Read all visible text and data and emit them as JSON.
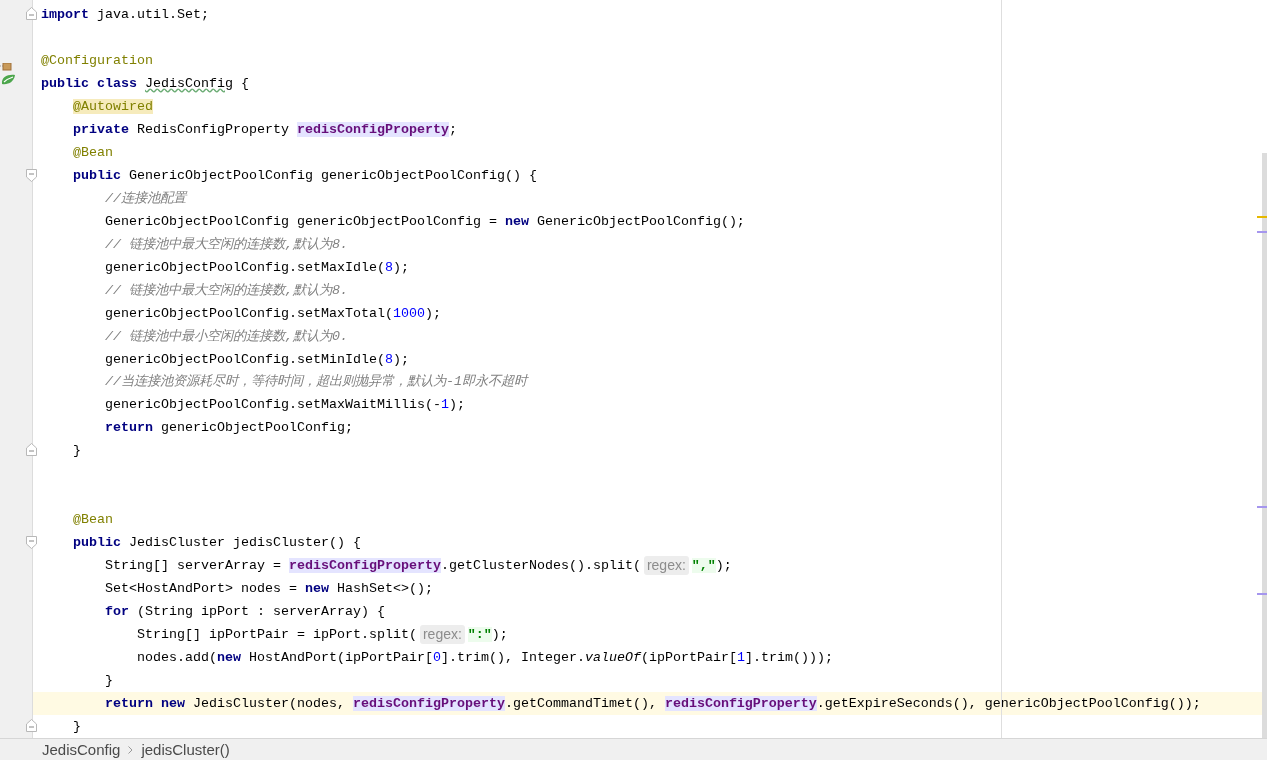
{
  "editor": {
    "lines": [
      {
        "gutter_icons": [
          {
            "kind": "fold-end"
          }
        ],
        "current": false,
        "tokens": [
          {
            "kind": "keyword",
            "text": "import"
          },
          {
            "kind": "plain",
            "text": " java.util.Set;"
          }
        ]
      },
      {
        "current": false
      },
      {
        "current": false,
        "tokens": [
          {
            "kind": "annotation",
            "text": "@Configuration"
          }
        ]
      },
      {
        "current": false,
        "gutter_icons": [
          {
            "kind": "spring-bean"
          }
        ],
        "tokens": [
          {
            "kind": "keyword",
            "text": "public class "
          },
          {
            "kind": "typo",
            "text": "JedisConfig"
          },
          {
            "kind": "plain",
            "text": " {"
          }
        ],
        "children": [
          {
            "current": false,
            "tokens": [
              {
                "kind": "annotation_marked",
                "text": "@Autowired"
              }
            ]
          },
          {
            "current": false,
            "tokens": [
              {
                "kind": "keyword",
                "text": "private"
              },
              {
                "kind": "plain",
                "text": " RedisConfigProperty "
              },
              {
                "kind": "field",
                "text": "redisConfigProperty"
              },
              {
                "kind": "plain",
                "text": ";"
              }
            ]
          },
          {
            "current": false,
            "tokens": [
              {
                "kind": "annotation",
                "text": "@Bean"
              }
            ]
          },
          {
            "gutter_icons": [
              {
                "kind": "fold-start"
              }
            ],
            "current": false,
            "tokens": [
              {
                "kind": "keyword",
                "text": "public"
              },
              {
                "kind": "plain",
                "text": " GenericObjectPoolConfig genericObjectPoolConfig() {"
              }
            ],
            "children": [
              {
                "current": false,
                "tokens": [
                  {
                    "kind": "comment",
                    "text": "//连接池配置"
                  }
                ]
              },
              {
                "current": false,
                "tokens": [
                  {
                    "kind": "plain",
                    "text": "GenericObjectPoolConfig genericObjectPoolConfig = "
                  },
                  {
                    "kind": "keyword",
                    "text": "new"
                  },
                  {
                    "kind": "plain",
                    "text": " GenericObjectPoolConfig();"
                  }
                ]
              },
              {
                "current": false,
                "tokens": [
                  {
                    "kind": "comment",
                    "text": "// 链接池中最大空闲的连接数,默认为8."
                  }
                ]
              },
              {
                "current": false,
                "tokens": [
                  {
                    "kind": "plain",
                    "text": "genericObjectPoolConfig.setMaxIdle("
                  },
                  {
                    "kind": "number",
                    "text": "8"
                  },
                  {
                    "kind": "plain",
                    "text": ");"
                  }
                ]
              },
              {
                "current": false,
                "tokens": [
                  {
                    "kind": "comment",
                    "text": "// 链接池中最大空闲的连接数,默认为8."
                  }
                ]
              },
              {
                "current": false,
                "tokens": [
                  {
                    "kind": "plain",
                    "text": "genericObjectPoolConfig.setMaxTotal("
                  },
                  {
                    "kind": "number",
                    "text": "1000"
                  },
                  {
                    "kind": "plain",
                    "text": ");"
                  }
                ]
              },
              {
                "current": false,
                "tokens": [
                  {
                    "kind": "comment",
                    "text": "// 链接池中最小空闲的连接数,默认为0."
                  }
                ]
              },
              {
                "current": false,
                "tokens": [
                  {
                    "kind": "plain",
                    "text": "genericObjectPoolConfig.setMinIdle("
                  },
                  {
                    "kind": "number",
                    "text": "8"
                  },
                  {
                    "kind": "plain",
                    "text": ");"
                  }
                ]
              },
              {
                "current": false,
                "tokens": [
                  {
                    "kind": "comment",
                    "text": "//当连接池资源耗尽时，等待时间，超出则抛异常，默认为-1即永不超时"
                  }
                ]
              },
              {
                "current": false,
                "tokens": [
                  {
                    "kind": "plain",
                    "text": "genericObjectPoolConfig.setMaxWaitMillis(-"
                  },
                  {
                    "kind": "number",
                    "text": "1"
                  },
                  {
                    "kind": "plain",
                    "text": ");"
                  }
                ]
              },
              {
                "current": false,
                "tokens": [
                  {
                    "kind": "keyword",
                    "text": "return"
                  },
                  {
                    "kind": "plain",
                    "text": " genericObjectPoolConfig;"
                  }
                ]
              }
            ]
          },
          {
            "gutter_icons": [
              {
                "kind": "fold-end"
              }
            ],
            "current": false,
            "tokens": [
              {
                "kind": "plain",
                "text": "}"
              }
            ]
          },
          {
            "current": false
          },
          {
            "current": false
          },
          {
            "current": false,
            "tokens": [
              {
                "kind": "annotation",
                "text": "@Bean"
              }
            ]
          },
          {
            "gutter_icons": [
              {
                "kind": "fold-start"
              }
            ],
            "current": false,
            "tokens": [
              {
                "kind": "keyword",
                "text": "public"
              },
              {
                "kind": "plain",
                "text": " JedisCluster jedisCluster() {"
              }
            ],
            "children": [
              {
                "current": false,
                "tokens": [
                  {
                    "kind": "plain",
                    "text": "String[] serverArray = "
                  },
                  {
                    "kind": "field",
                    "text": "redisConfigProperty"
                  },
                  {
                    "kind": "plain",
                    "text": ".getClusterNodes().split("
                  },
                  {
                    "kind": "hint",
                    "text": "regex:"
                  },
                  {
                    "kind": "string",
                    "text": "\",\""
                  },
                  {
                    "kind": "plain",
                    "text": ");"
                  }
                ]
              },
              {
                "current": false,
                "tokens": [
                  {
                    "kind": "plain",
                    "text": "Set<HostAndPort> nodes = "
                  },
                  {
                    "kind": "keyword",
                    "text": "new"
                  },
                  {
                    "kind": "plain",
                    "text": " HashSet<>();"
                  }
                ]
              },
              {
                "current": false,
                "tokens": [
                  {
                    "kind": "keyword",
                    "text": "for"
                  },
                  {
                    "kind": "plain",
                    "text": " (String ipPort : serverArray) {"
                  }
                ],
                "children": [
                  {
                    "current": false,
                    "tokens": [
                      {
                        "kind": "plain",
                        "text": "String[] ipPortPair = ipPort.split("
                      },
                      {
                        "kind": "hint",
                        "text": "regex:"
                      },
                      {
                        "kind": "string",
                        "text": "\":\""
                      },
                      {
                        "kind": "plain",
                        "text": ");"
                      }
                    ]
                  },
                  {
                    "current": false,
                    "tokens": [
                      {
                        "kind": "plain",
                        "text": "nodes.add("
                      },
                      {
                        "kind": "keyword",
                        "text": "new"
                      },
                      {
                        "kind": "plain",
                        "text": " HostAndPort(ipPortPair["
                      },
                      {
                        "kind": "number",
                        "text": "0"
                      },
                      {
                        "kind": "plain",
                        "text": "].trim(), Integer."
                      },
                      {
                        "kind": "static_call",
                        "text": "valueOf"
                      },
                      {
                        "kind": "plain",
                        "text": "(ipPortPair["
                      },
                      {
                        "kind": "number",
                        "text": "1"
                      },
                      {
                        "kind": "plain",
                        "text": "].trim()));"
                      }
                    ]
                  }
                ]
              },
              {
                "current": false,
                "tokens": [
                  {
                    "kind": "plain",
                    "text": "}"
                  }
                ]
              },
              {
                "current": true,
                "tokens": [
                  {
                    "kind": "keyword",
                    "text": "return new"
                  },
                  {
                    "kind": "plain",
                    "text": " JedisCluster(nodes, "
                  },
                  {
                    "kind": "field",
                    "text": "redisConfigProperty"
                  },
                  {
                    "kind": "plain",
                    "text": ".getCommandTimet(), "
                  },
                  {
                    "kind": "field",
                    "text": "redisConfigProperty"
                  },
                  {
                    "kind": "plain",
                    "text": ".getExpireSeconds(), genericObjectPoolConfig());"
                  }
                ]
              }
            ]
          },
          {
            "gutter_icons": [
              {
                "kind": "fold-end"
              }
            ],
            "current": false,
            "tokens": [
              {
                "kind": "plain",
                "text": "}"
              }
            ]
          }
        ]
      }
    ]
  },
  "breadcrumbs": [
    {
      "label": "JedisConfig"
    },
    {
      "label": "jedisCluster()"
    }
  ]
}
